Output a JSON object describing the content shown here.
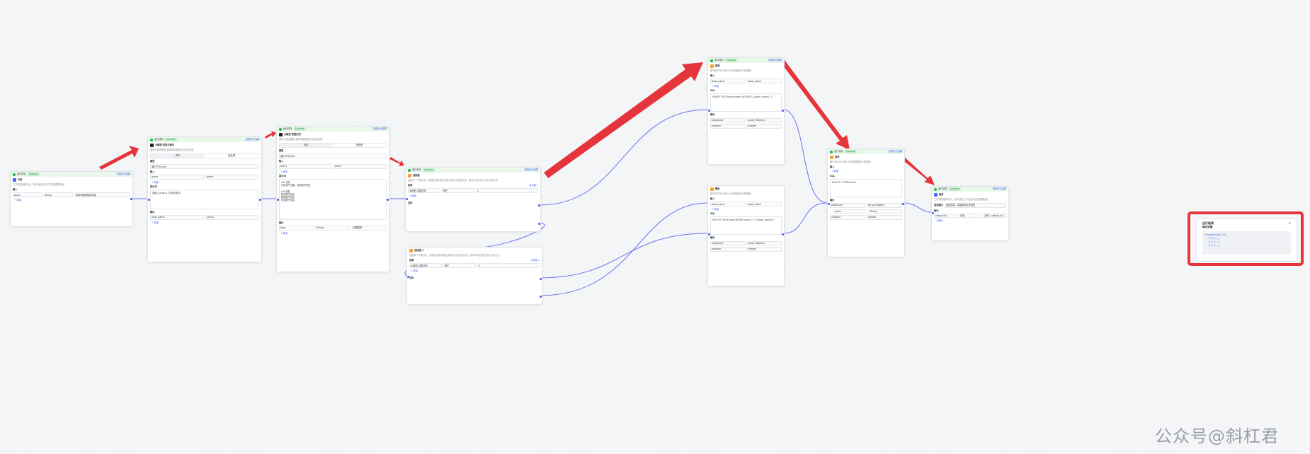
{
  "common": {
    "run_label": "运行成功",
    "success_badge": "Success",
    "detail_link": "查看运行结果",
    "input_section": "输入",
    "output_section": "输出",
    "add_label": "+ 新增",
    "param_name_header": "参数名",
    "param_value_header": "参数值",
    "param_type_header": "变量类型"
  },
  "start_node": {
    "title": "开始",
    "desc": "工作流的起始节点，用于设定启动工作流需要的信息",
    "var_name": "query",
    "var_type": "String",
    "var_desc": "查询问题的描述内容"
  },
  "llm1": {
    "title": "大模型-提取关键词",
    "desc": "调用大语言模型,使用变量和提示词生成回复",
    "model_section": "模型",
    "model_value": "通义千问-Max",
    "tab1": "单次",
    "tab2": "批处理",
    "prompt_section": "提示词",
    "prompt_text": "提取{{query}}中的关键词",
    "out_name": "book_name",
    "out_type": "String"
  },
  "llm2": {
    "title": "大模型-意图识别",
    "desc": "调用大语言模型,使用变量和提示词生成回复",
    "prompt_text": "## 任务\n分析用户意图，判断操作类型\n\n## 类型\n新增图书信息\n删除图书信息\n查询图书信息",
    "out_name": "type",
    "out_type": "String",
    "out_desc": "意图类型"
  },
  "cond1": {
    "title": "选择器",
    "desc": "连接多个下游分支，若设定的条件成立则仅运行对应的分支，若均不成立则只运行否则分支",
    "if_label": "如果",
    "priority": "优先级 1",
    "var": "大模型-意图识别",
    "op": "等于",
    "value": "1",
    "else_label": "否则"
  },
  "cond2": {
    "title": "选择器_1",
    "desc": "连接多个下游分支，若设定的条件成立则仅运行对应的分支，若均不成立则只运行否则分支",
    "if_label": "如果",
    "priority": "优先级 1",
    "var": "大模型-意图识别",
    "op": "等于",
    "value": "2",
    "else_label": "否则"
  },
  "sql_add": {
    "title": "新增",
    "desc": "基于用户定义的SQL查询数据库中的数据",
    "in_name": "book_name",
    "sql_section": "SQL",
    "sql_text": "INSERT INTO book(name) VALUES(\"{{book_name}}\")",
    "out1": "outputList",
    "out1_type": "Array<Object>",
    "out2": "rowNum",
    "out2_type": "Integer"
  },
  "sql_del": {
    "title": "删除",
    "desc": "基于用户定义的SQL查询数据库中的数据",
    "in_name": "book_name",
    "sql_section": "SQL",
    "sql_text": "DELETE FROM book WHERE name = \"{{book_name}}\"",
    "out1": "outputList",
    "out1_type": "Array<Object>",
    "out2": "rowNum",
    "out2_type": "Integer"
  },
  "sql_query": {
    "title": "查询",
    "desc": "基于用户定义的SQL查询数据库中的数据",
    "sql_section": "SQL",
    "sql_text": "SELECT * FROM book",
    "out1": "outputList",
    "out1_type": "Array<Object>",
    "out2": "name",
    "out2_type": "String",
    "out3": "rowNum",
    "out3_type": "Integer"
  },
  "end_node": {
    "title": "结束",
    "desc": "工作流的最终节点，用于返回工作流运行后的结果信息",
    "mode_label": "回答模式",
    "mode_value": "返回变量，由智能体生成回答",
    "out_name": "outputList",
    "out_type": "引用",
    "out_src": "查询 - outputList"
  },
  "result_panel": {
    "title": "运行结果",
    "close": "×",
    "section": "输出变量",
    "items": [
      "▾ outputList: [3]",
      "▸ 0: {...}",
      "▸ 1: {...}",
      "▸ 2: {...}"
    ]
  },
  "watermark": "公众号@斜杠君"
}
